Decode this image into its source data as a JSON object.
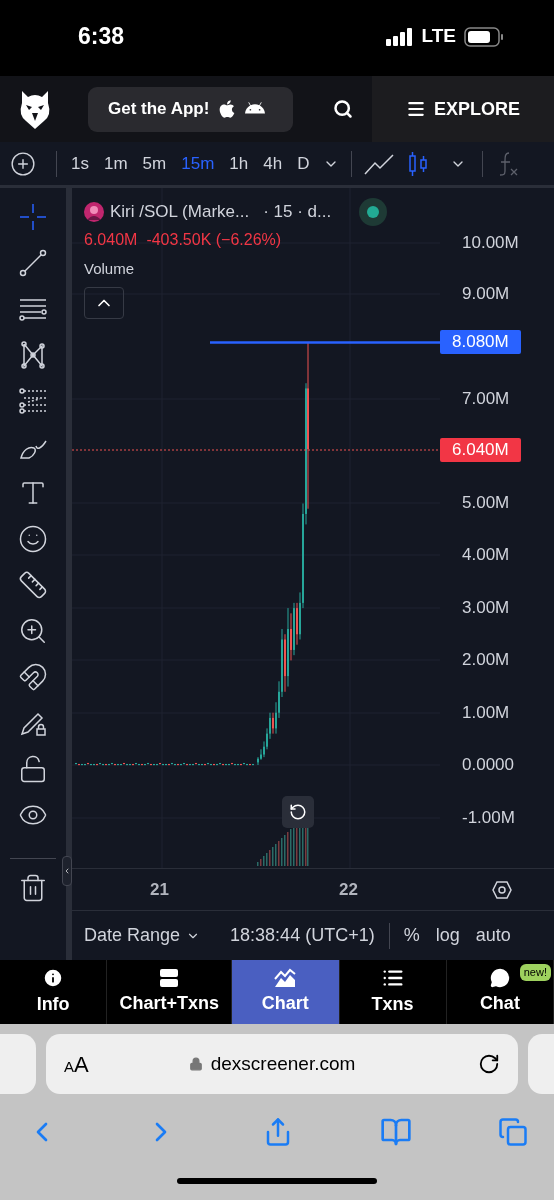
{
  "status_bar": {
    "time": "6:38",
    "network": "LTE"
  },
  "header": {
    "app_button": "Get the App!",
    "explore": "EXPLORE"
  },
  "toolbar": {
    "intervals": [
      {
        "label": "1s",
        "selected": false
      },
      {
        "label": "1m",
        "selected": false
      },
      {
        "label": "5m",
        "selected": false
      },
      {
        "label": "15m",
        "selected": true
      },
      {
        "label": "1h",
        "selected": false
      },
      {
        "label": "4h",
        "selected": false
      },
      {
        "label": "D",
        "selected": false
      }
    ],
    "chart_types": [
      {
        "kind": "line",
        "selected": false
      },
      {
        "kind": "candles",
        "selected": true
      }
    ]
  },
  "tools": [
    {
      "kind": "crosshair",
      "selected": true
    },
    {
      "kind": "trend-line",
      "selected": false
    },
    {
      "kind": "parallel-lines",
      "selected": false
    },
    {
      "kind": "pattern",
      "selected": false
    },
    {
      "kind": "fib-levels",
      "selected": false
    },
    {
      "kind": "brush",
      "selected": false
    },
    {
      "kind": "text",
      "selected": false
    },
    {
      "kind": "emoji",
      "selected": false
    },
    {
      "kind": "ruler",
      "selected": false
    },
    {
      "kind": "zoom",
      "selected": false
    },
    {
      "kind": "magnet",
      "selected": false
    },
    {
      "kind": "pencil-lock",
      "selected": false
    },
    {
      "kind": "lock",
      "selected": false
    },
    {
      "kind": "eye",
      "selected": false
    },
    {
      "kind": "trash",
      "selected": false
    }
  ],
  "legend": {
    "symbol": "Kiri /SOL (Marke...",
    "details": "· 15 · d...",
    "price": "6.040M",
    "change": "-403.50K (−6.26%)",
    "indicator": "Volume",
    "live": true
  },
  "price_axis": [
    {
      "label": "10.00M",
      "kind": "tick"
    },
    {
      "label": "9.00M",
      "kind": "tick"
    },
    {
      "label": "8.080M",
      "kind": "line"
    },
    {
      "label": "7.00M",
      "kind": "tick"
    },
    {
      "label": "6.040M",
      "kind": "last"
    },
    {
      "label": "5.00M",
      "kind": "tick"
    },
    {
      "label": "4.00M",
      "kind": "tick"
    },
    {
      "label": "3.00M",
      "kind": "tick"
    },
    {
      "label": "2.00M",
      "kind": "tick"
    },
    {
      "label": "1.00M",
      "kind": "tick"
    },
    {
      "label": "0.0000",
      "kind": "tick"
    },
    {
      "label": "-1.00M",
      "kind": "tick"
    }
  ],
  "time_axis": [
    "21",
    "22"
  ],
  "bottom_bar": {
    "date_range": "Date Range",
    "time": "18:38:44 (UTC+1)",
    "percent": "%",
    "log": "log",
    "auto": "auto"
  },
  "nav_tabs": [
    {
      "label": "Info",
      "kind": "info",
      "selected": false
    },
    {
      "label": "Chart+Txns",
      "kind": "split",
      "selected": false
    },
    {
      "label": "Chart",
      "kind": "chart",
      "selected": true
    },
    {
      "label": "Txns",
      "kind": "list",
      "selected": false
    },
    {
      "label": "Chat",
      "kind": "chat",
      "selected": false,
      "badge": "new!"
    }
  ],
  "browser": {
    "text_size": "AA",
    "url": "dexscreener.com"
  }
}
